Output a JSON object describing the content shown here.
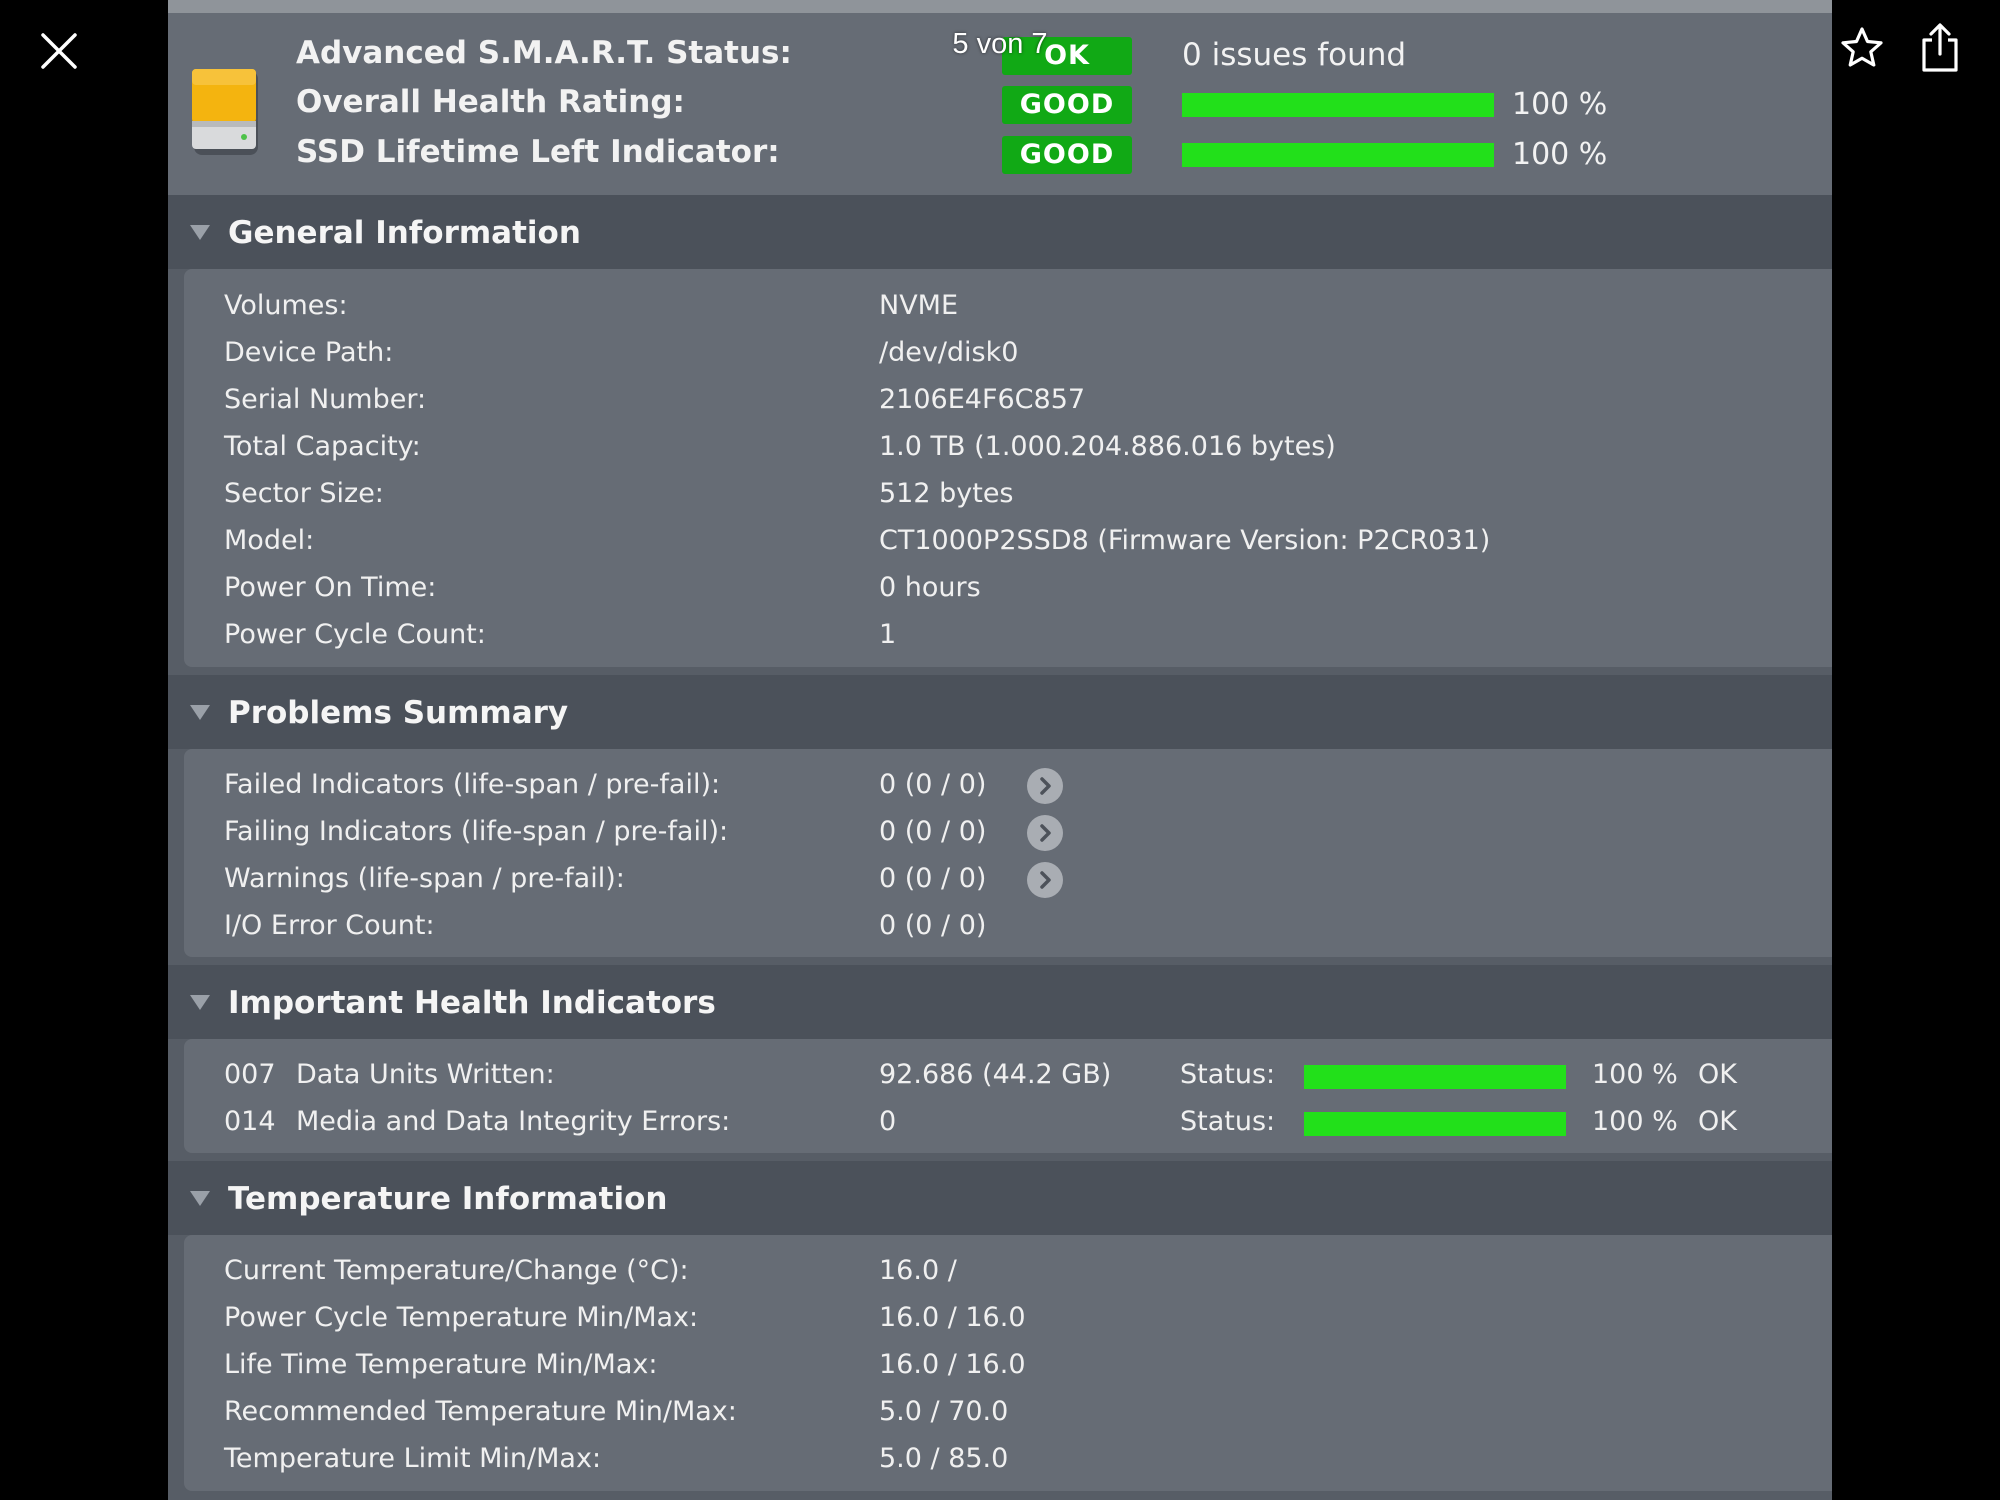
{
  "viewer": {
    "page_counter": "5 von 7",
    "icons": {
      "close": "close-icon",
      "favorite": "star-icon",
      "share": "share-icon"
    }
  },
  "summary": {
    "disk_icon": "hard-disk-icon",
    "rows": [
      {
        "label": "Advanced S.M.A.R.T. Status:",
        "badge": "OK",
        "text": "0 issues found"
      },
      {
        "label": "Overall Health Rating:",
        "badge": "GOOD",
        "percent_text": "100 %",
        "level": 100
      },
      {
        "label": "SSD Lifetime Left Indicator:",
        "badge": "GOOD",
        "percent_text": "100 %",
        "level": 100
      }
    ]
  },
  "general": {
    "title": "General Information",
    "rows": [
      {
        "label": "Volumes:",
        "value": "NVME"
      },
      {
        "label": "Device Path:",
        "value": "/dev/disk0"
      },
      {
        "label": "Serial Number:",
        "value": "2106E4F6C857"
      },
      {
        "label": "Total Capacity:",
        "value": "1.0 TB (1.000.204.886.016 bytes)"
      },
      {
        "label": "Sector Size:",
        "value": "512 bytes"
      },
      {
        "label": "Model:",
        "value": "CT1000P2SSD8  (Firmware Version: P2CR031)"
      },
      {
        "label": "Power On Time:",
        "value": "0 hours"
      },
      {
        "label": "Power Cycle Count:",
        "value": "1"
      }
    ]
  },
  "problems": {
    "title": "Problems Summary",
    "rows": [
      {
        "label": "Failed Indicators (life-span / pre-fail):",
        "value": "0  (0 / 0)"
      },
      {
        "label": "Failing Indicators (life-span / pre-fail):",
        "value": "0  (0 / 0)"
      },
      {
        "label": "Warnings (life-span / pre-fail):",
        "value": "0  (0 / 0)"
      },
      {
        "label": "I/O Error Count:",
        "value": "0  (0 / 0)"
      }
    ]
  },
  "health": {
    "title": "Important Health Indicators",
    "rows": [
      {
        "id": "007",
        "label": "Data Units Written:",
        "value": "92.686 (44.2 GB)",
        "status_label": "Status:",
        "level": 100,
        "percent_text": "100 %",
        "status": "OK"
      },
      {
        "id": "014",
        "label": "Media and Data Integrity Errors:",
        "value": "0",
        "status_label": "Status:",
        "level": 100,
        "percent_text": "100 %",
        "status": "OK"
      }
    ]
  },
  "temperature": {
    "title": "Temperature Information",
    "rows": [
      {
        "label": "Current Temperature/Change (°C):",
        "value": "16.0 /"
      },
      {
        "label": "Power Cycle Temperature Min/Max:",
        "value": "16.0 / 16.0"
      },
      {
        "label": "Life Time Temperature Min/Max:",
        "value": "16.0 / 16.0"
      },
      {
        "label": "Recommended Temperature Min/Max:",
        "value": "5.0   / 70.0"
      },
      {
        "label": "Temperature Limit Min/Max:",
        "value": "5.0   / 85.0"
      }
    ]
  },
  "colors": {
    "good_badge": "#11a915",
    "level_bar": "#22e01a",
    "panel_bg": "#666c75",
    "section_header_bg": "#4b515a"
  }
}
